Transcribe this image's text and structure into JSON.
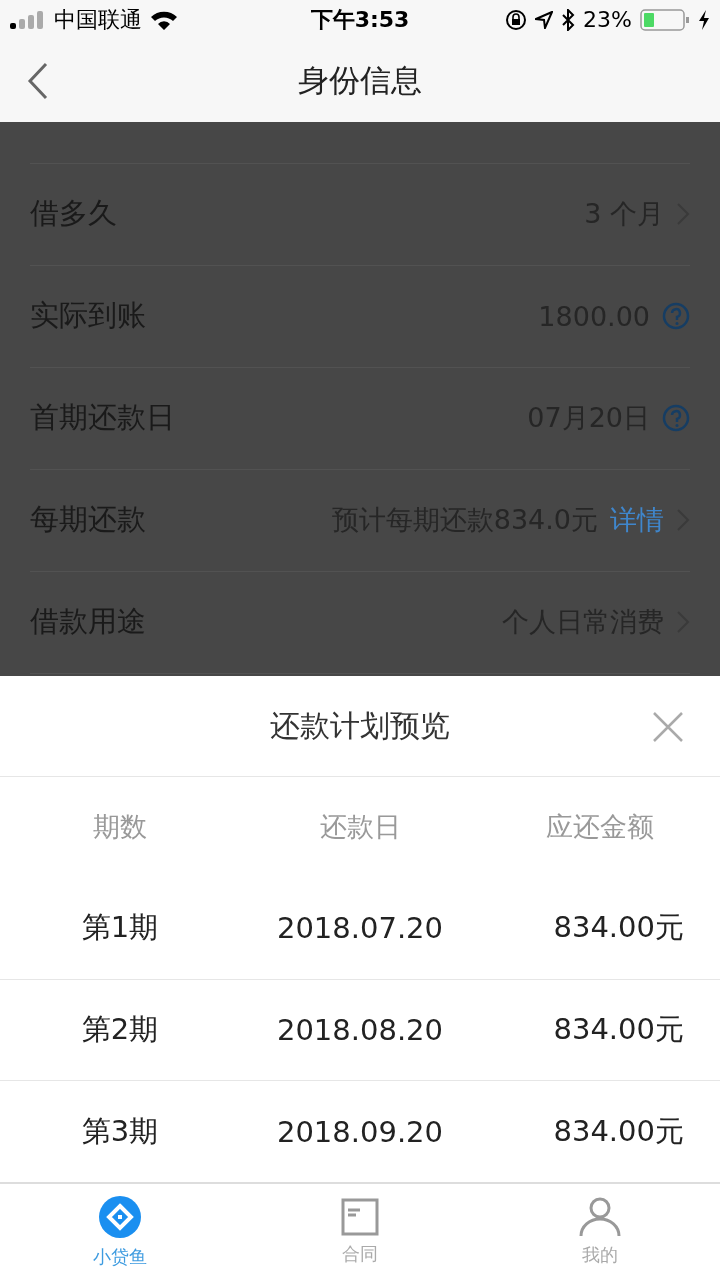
{
  "status_bar": {
    "carrier": "中国联通",
    "time": "下午3:53",
    "battery": "23%"
  },
  "nav": {
    "title": "身份信息"
  },
  "form_rows": [
    {
      "label": "借多久",
      "value": "3 个月",
      "kind": "chevron"
    },
    {
      "label": "实际到账",
      "value": "1800.00",
      "kind": "help"
    },
    {
      "label": "首期还款日",
      "value": "07月20日",
      "kind": "help"
    },
    {
      "label": "每期还款",
      "value": "预计每期还款834.0元",
      "link": "详情",
      "kind": "chevron"
    },
    {
      "label": "借款用途",
      "value": "个人日常消费",
      "kind": "chevron"
    }
  ],
  "sheet": {
    "title": "还款计划预览",
    "columns": [
      "期数",
      "还款日",
      "应还金额"
    ],
    "rows": [
      [
        "第1期",
        "2018.07.20",
        "834.00元"
      ],
      [
        "第2期",
        "2018.08.20",
        "834.00元"
      ],
      [
        "第3期",
        "2018.09.20",
        "834.00元"
      ]
    ]
  },
  "tab_bar": [
    {
      "label": "小贷鱼",
      "kind": "home",
      "selected": true
    },
    {
      "label": "合同",
      "kind": "contract",
      "selected": false
    },
    {
      "label": "我的",
      "kind": "profile",
      "selected": false
    }
  ]
}
